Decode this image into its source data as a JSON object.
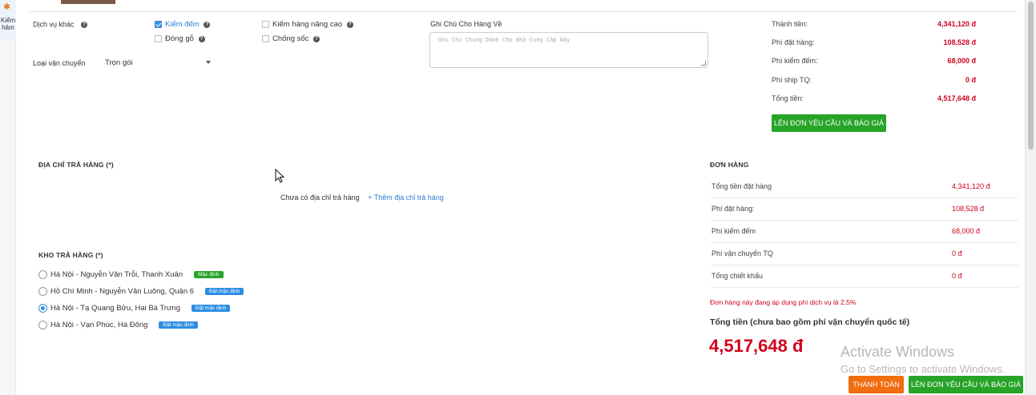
{
  "sidebar": {
    "item_label": "Kiểm\nhâm"
  },
  "services": {
    "label": "Dịch vụ khác",
    "options": [
      {
        "label": "Kiểm đếm",
        "checked": true
      },
      {
        "label": "Đóng gỗ",
        "checked": false
      },
      {
        "label": "Kiểm hàng nâng cao",
        "checked": false
      },
      {
        "label": "Chống sốc",
        "checked": false
      }
    ]
  },
  "shipping": {
    "label": "Loại vận chuyển",
    "selected": "Trọn gói"
  },
  "note": {
    "label": "Ghi Chú Cho Hàng Về",
    "placeholder": "Ghi Chú Chung Dành Cho Nhà Cung Cấp Này"
  },
  "summary": [
    {
      "label": "Thành tiền:",
      "value": "4,341,120 đ"
    },
    {
      "label": "Phí đặt hàng:",
      "value": "108,528 đ"
    },
    {
      "label": "Phí kiểm đếm:",
      "value": "68,000 đ"
    },
    {
      "label": "Phí ship TQ:",
      "value": "0 đ"
    },
    {
      "label": "Tổng tiền:",
      "value": "4,517,648 đ"
    }
  ],
  "summary_button": "LÊN ĐƠN YÊU CẦU VÀ BÁO GIÁ",
  "address": {
    "title": "ĐỊA CHỈ TRẢ HÀNG (*)",
    "empty_text": "Chưa có địa chỉ trả hàng",
    "add_link": "+ Thêm địa chỉ trả hàng"
  },
  "warehouse": {
    "title": "KHO TRẢ HÀNG (*)",
    "items": [
      {
        "name": "Hà Nội - Nguyễn Văn Trỗi, Thanh Xuân",
        "badge": "Mặc định",
        "selected": false
      },
      {
        "name": "Hồ Chí Minh - Nguyễn Văn Luông, Quận 6",
        "badge": "Đặt mặc định",
        "selected": false
      },
      {
        "name": "Hà Nội - Tạ Quang Bửu, Hai Bà Trưng",
        "badge": "Đặt mặc định",
        "selected": true
      },
      {
        "name": "Hà Nội - Vạn Phúc, Hà Đông",
        "badge": "Đặt mặc định",
        "selected": false
      }
    ]
  },
  "order": {
    "title": "ĐƠN HÀNG",
    "rows": [
      {
        "label": "Tổng tiền đặt hàng",
        "value": "4,341,120 đ"
      },
      {
        "label": "Phí đặt hàng:",
        "value": "108,528 đ"
      },
      {
        "label": "Phí kiểm đếm",
        "value": "68,000 đ"
      },
      {
        "label": "Phí vận chuyển TQ",
        "value": "0 đ"
      },
      {
        "label": "Tổng chiết khấu",
        "value": "0 đ"
      }
    ],
    "notice": "Đơn hàng này đang áp dụng phí dịch vụ là 2.5%",
    "total_label": "Tổng tiền (chưa bao gồm phí vận chuyển quốc tế)",
    "total_value": "4,517,648 đ"
  },
  "footer": {
    "pay_button": "THANH TOÁN",
    "quote_button": "LÊN ĐƠN YÊU CẦU VÀ BÁO GIÁ"
  },
  "watermark": {
    "line1": "Activate Windows",
    "line2": "Go to Settings to activate Windows."
  },
  "colors": {
    "accent_blue": "#2a7fd4",
    "price_red": "#d0021b",
    "button_green": "#27a427",
    "button_orange": "#f06d10"
  }
}
